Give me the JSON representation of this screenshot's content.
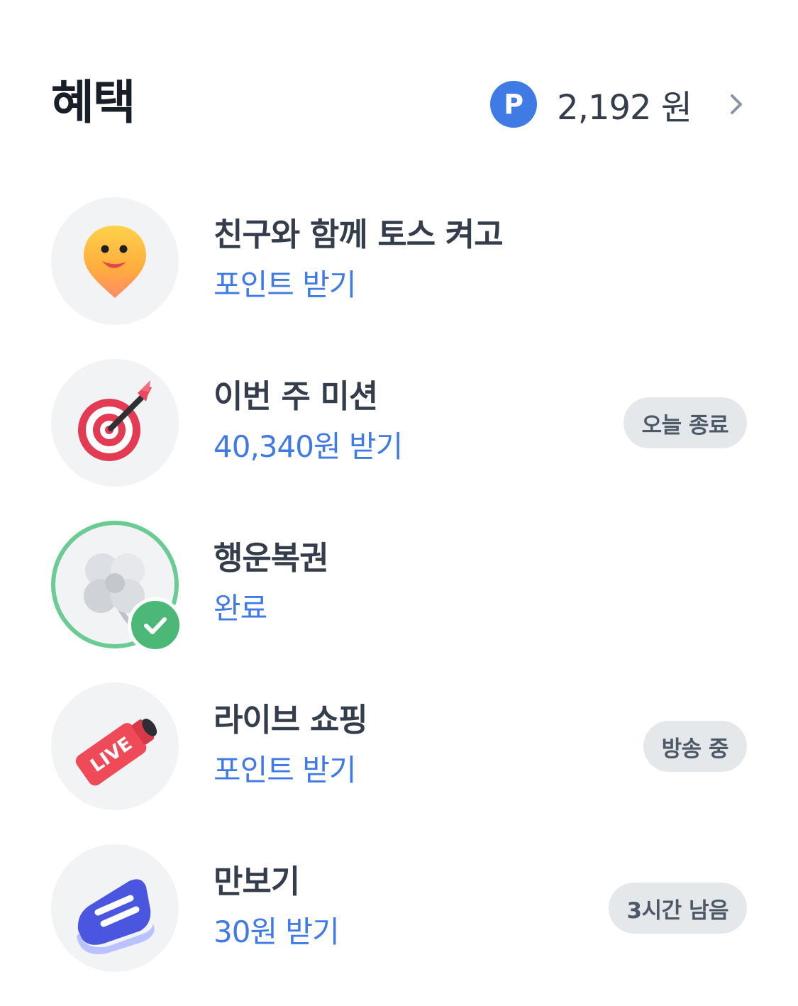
{
  "header": {
    "title": "혜택",
    "point_symbol": "P",
    "points_amount": "2,192 원"
  },
  "items": [
    {
      "title": "친구와 함께 토스 켜고",
      "subtitle": "포인트 받기",
      "badge": "",
      "icon": "smiley-location-pin-icon"
    },
    {
      "title": "이번 주 미션",
      "subtitle": "40,340원 받기",
      "badge": "오늘 종료",
      "icon": "target-dart-icon"
    },
    {
      "title": "행운복권",
      "subtitle": "완료",
      "badge": "",
      "icon": "clover-icon",
      "completed": true
    },
    {
      "title": "라이브 쇼핑",
      "subtitle": "포인트 받기",
      "badge": "방송 중",
      "icon": "live-megaphone-icon"
    },
    {
      "title": "만보기",
      "subtitle": "30원 받기",
      "badge": "3시간 남음",
      "icon": "sneaker-icon"
    }
  ],
  "colors": {
    "accent_blue": "#3f7ae5",
    "title_dark": "#191f28",
    "success_green": "#4cb878",
    "pill_bg": "#e5e8eb"
  }
}
